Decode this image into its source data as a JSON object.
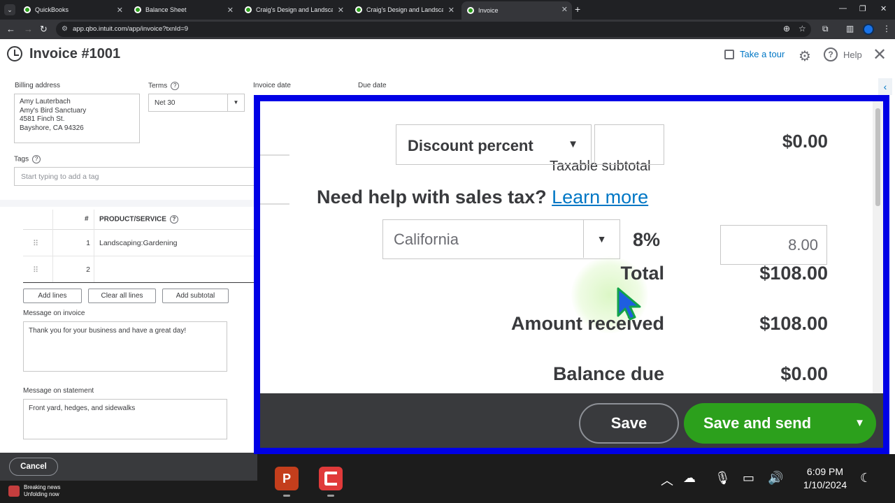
{
  "browser": {
    "tabs": [
      {
        "title": "QuickBooks"
      },
      {
        "title": "Balance Sheet"
      },
      {
        "title": "Craig's Design and Landscaping"
      },
      {
        "title": "Craig's Design and Landscaping"
      },
      {
        "title": "Invoice"
      }
    ],
    "url": "app.qbo.intuit.com/app/invoice?txnId=9"
  },
  "header": {
    "title": "Invoice #1001",
    "take_tour": "Take a tour",
    "help": "Help"
  },
  "form": {
    "billing_label": "Billing address",
    "billing_lines": [
      "Amy Lauterbach",
      "Amy's Bird Sanctuary",
      "4581 Finch St.",
      "Bayshore, CA  94326"
    ],
    "terms_label": "Terms",
    "terms_value": "Net 30",
    "invoice_date_label": "Invoice date",
    "due_date_label": "Due date",
    "tags_label": "Tags",
    "tags_placeholder": "Start typing to add a tag"
  },
  "table": {
    "col_num": "#",
    "col_product": "PRODUCT/SERVICE",
    "rows": [
      {
        "num": "1",
        "product": "Landscaping:Gardening"
      },
      {
        "num": "2",
        "product": ""
      }
    ]
  },
  "actions": {
    "add_lines": "Add lines",
    "clear_all_lines": "Clear all lines",
    "add_subtotal": "Add subtotal"
  },
  "messages": {
    "invoice_label": "Message on invoice",
    "invoice_text": "Thank you for your business and have a great day!",
    "statement_label": "Message on statement",
    "statement_text": "Front yard, hedges, and sidewalks"
  },
  "footer": {
    "cancel": "Cancel"
  },
  "zoom": {
    "discount_select": "Discount percent",
    "discount_amount": "$0.00",
    "taxable_subtotal": "Taxable subtotal",
    "need_help": "Need help with sales tax?",
    "learn_more": "Learn more",
    "tax_region": "California",
    "tax_rate": "8%",
    "tax_amount": "8.00",
    "total_label": "Total",
    "total_value": "$108.00",
    "amount_received_label": "Amount received",
    "amount_received_value": "$108.00",
    "balance_due_label": "Balance due",
    "balance_due_value": "$0.00",
    "save": "Save",
    "save_and_send": "Save and send"
  },
  "taskbar": {
    "news_title": "Breaking news",
    "news_sub": "Unfolding now",
    "time": "6:09 PM",
    "date": "1/10/2024"
  },
  "colors": {
    "accent_green": "#2ca01c",
    "link_blue": "#0077c5",
    "highlight_frame": "#0000e6"
  }
}
